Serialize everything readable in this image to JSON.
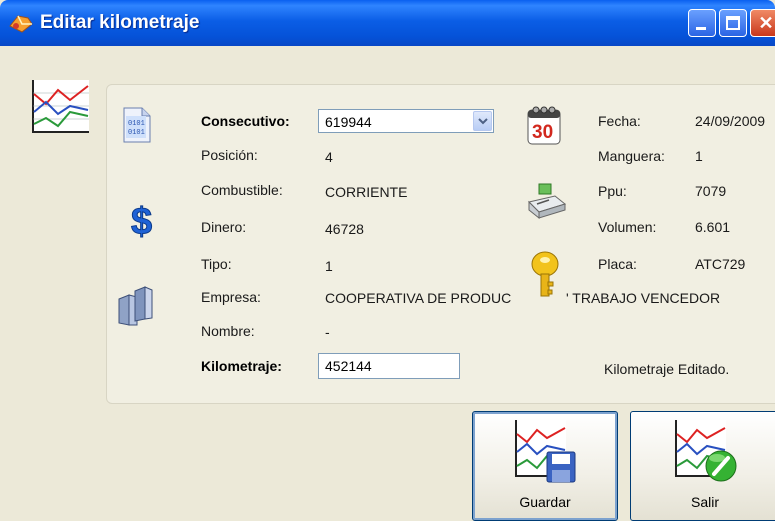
{
  "window": {
    "title": "Editar kilometraje",
    "controls": [
      "minimize",
      "maximize",
      "close"
    ]
  },
  "form": {
    "consecutivo": {
      "label": "Consecutivo:",
      "value": "619944"
    },
    "posicion": {
      "label": "Posición:",
      "value": "4"
    },
    "combustible": {
      "label": "Combustible:",
      "value": "CORRIENTE"
    },
    "dinero": {
      "label": "Dinero:",
      "value": "46728"
    },
    "tipo": {
      "label": "Tipo:",
      "value": "1"
    },
    "empresa": {
      "label": "Empresa:",
      "value_part1": "COOPERATIVA DE PRODUC",
      "value_part2": "' TRABAJO VENCEDOR"
    },
    "nombre": {
      "label": "Nombre:",
      "value": "-"
    },
    "kilometraje": {
      "label": "Kilometraje:",
      "value": "452144"
    },
    "fecha": {
      "label": "Fecha:",
      "value": "24/09/2009"
    },
    "manguera": {
      "label": "Manguera:",
      "value": "1"
    },
    "ppu": {
      "label": "Ppu:",
      "value": "7079"
    },
    "volumen": {
      "label": "Volumen:",
      "value": "6.601"
    },
    "placa": {
      "label": "Placa:",
      "value": "ATC729"
    },
    "status": "Kilometraje Editado."
  },
  "icons": {
    "calendar_day": "30"
  },
  "buttons": {
    "save": "Guardar",
    "exit": "Salir"
  },
  "colors": {
    "titlebar": "#0552d8",
    "window_bg": "#ece9d8",
    "panel_bg": "#f1efe2",
    "input_border": "#7f9db9"
  }
}
